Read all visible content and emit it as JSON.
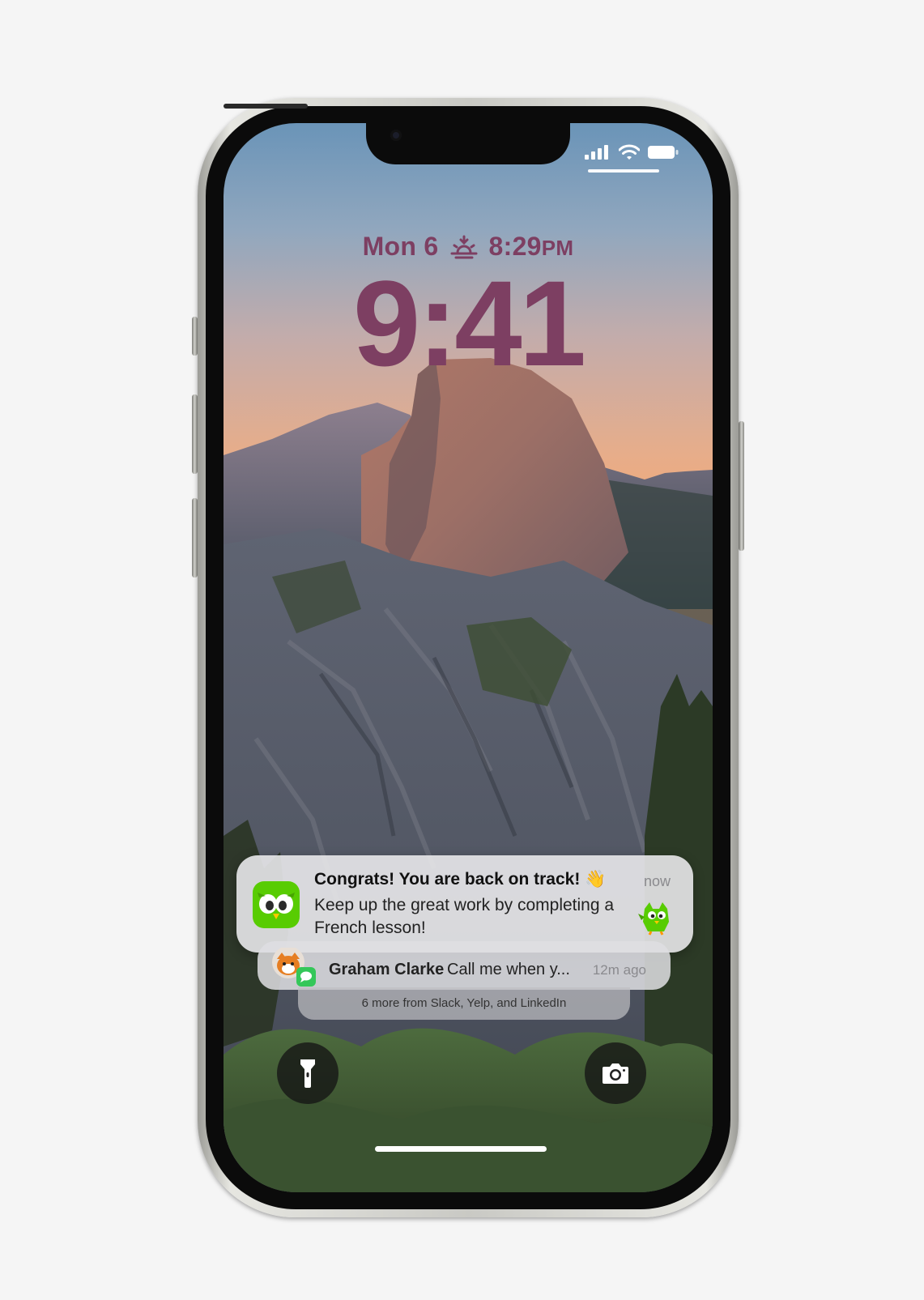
{
  "lock_screen": {
    "date": "Mon 6",
    "sunset_icon": "sunset-icon",
    "sunset_time": "8:29",
    "sunset_ampm": "PM",
    "time": "9:41"
  },
  "status_bar": {
    "signal_icon": "cellular-signal-icon",
    "wifi_icon": "wifi-icon",
    "battery_icon": "battery-icon"
  },
  "notifications": {
    "primary": {
      "app_icon": "duolingo-owl-icon",
      "title": "Congrats! You are back on track!",
      "title_emoji": "👋",
      "body": "Keep up the great work by completing a French lesson!",
      "time": "now",
      "attachment_icon": "duolingo-owl-sticker-icon"
    },
    "secondary": {
      "avatar_icon": "contact-avatar-icon",
      "app_badge_icon": "messages-icon",
      "sender": "Graham Clarke",
      "preview": "Call me when y...",
      "time": "12m ago"
    },
    "more_summary": "6 more from Slack, Yelp, and LinkedIn"
  },
  "controls": {
    "flashlight_icon": "flashlight-icon",
    "camera_icon": "camera-icon"
  },
  "colors": {
    "clock": "#7d3f62",
    "duolingo_green": "#58cc02",
    "messages_green": "#34c759"
  }
}
